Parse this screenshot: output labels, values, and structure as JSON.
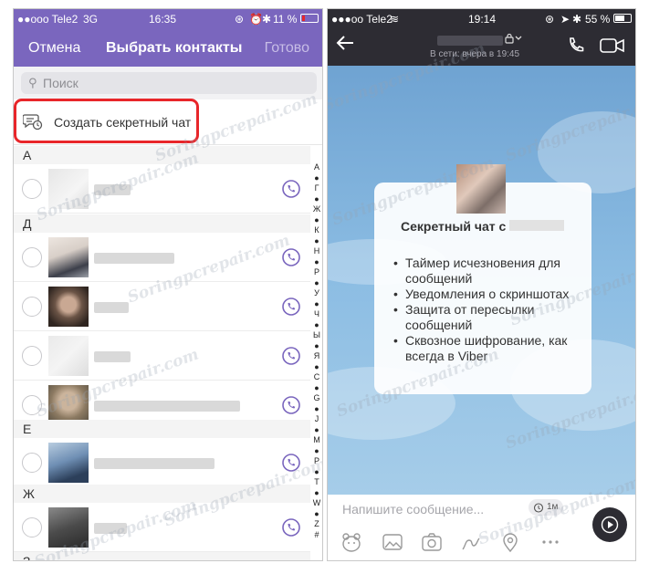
{
  "left": {
    "status": {
      "carrier": "●●ooo Tele2",
      "network": "3G",
      "time": "16:35",
      "battery": "11 %"
    },
    "header": {
      "cancel": "Отмена",
      "title": "Выбрать контакты",
      "done": "Готово"
    },
    "search": {
      "placeholder": "Поиск"
    },
    "secret_chat": {
      "label": "Создать секретный чат"
    },
    "sections": [
      {
        "letter": "А"
      },
      {
        "letter": "Д"
      },
      {
        "letter": "Е"
      },
      {
        "letter": "Ж"
      },
      {
        "letter": "З"
      }
    ],
    "index": [
      "А",
      "●",
      "Г",
      "●",
      "Ж",
      "●",
      "К",
      "●",
      "Н",
      "●",
      "Р",
      "●",
      "У",
      "●",
      "Ч",
      "●",
      "Ы",
      "●",
      "Я",
      "●",
      "С",
      "●",
      "G",
      "●",
      "J",
      "●",
      "M",
      "●",
      "P",
      "●",
      "T",
      "●",
      "W",
      "●",
      "Z",
      "#"
    ]
  },
  "right": {
    "status": {
      "carrier": "●●●oo Tele2",
      "time": "19:14",
      "battery": "55 %"
    },
    "header": {
      "online": "В сети: вчера в 19:45"
    },
    "card": {
      "title": "Секретный чат с",
      "features": [
        "Таймер исчезновения для сообщений",
        "Уведомления о скриншотах",
        "Защита от пересылки сообщений",
        "Сквозное шифрование, как всегда в Viber"
      ]
    },
    "composer": {
      "placeholder": "Напишите сообщение...",
      "timer": "1м"
    }
  },
  "watermark": "Soringpcrepair.com",
  "colors": {
    "viber_purple": "#7a66be",
    "highlight_red": "#e8262a",
    "dark_header": "#2d2c33"
  }
}
